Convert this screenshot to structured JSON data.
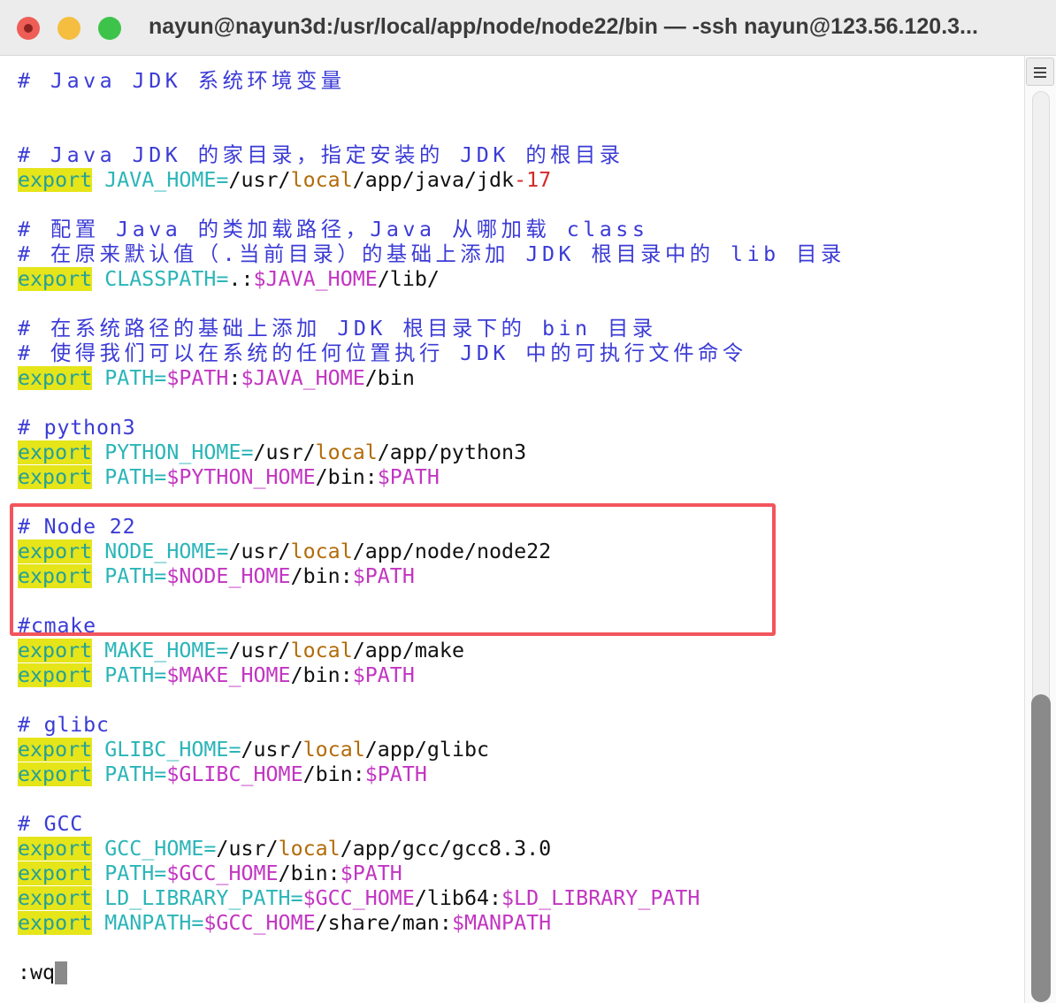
{
  "window": {
    "title": "nayun@nayun3d:/usr/local/app/node/node22/bin — -ssh nayun@123.56.120.3...",
    "buttons": [
      "close",
      "minimize",
      "zoom"
    ]
  },
  "colors": {
    "comment": "#3b3bd6",
    "keyword_bg": "#e5e51a",
    "variable": "#2bb5b8",
    "dollar_var": "#c235c2",
    "local": "#b36b0a",
    "highlight_box": "#f2555c"
  },
  "editor": {
    "lines": [
      {
        "type": "comment",
        "text": "# Java JDK 系统环境变量"
      },
      {
        "type": "blank"
      },
      {
        "type": "blank"
      },
      {
        "type": "comment",
        "text": "# Java JDK 的家目录，指定安装的 JDK 的根目录"
      },
      {
        "type": "code",
        "segments": [
          {
            "c": "kw",
            "t": "export"
          },
          {
            "c": "plain",
            "t": " "
          },
          {
            "c": "var",
            "t": "JAVA_HOME="
          },
          {
            "c": "plain",
            "t": "/usr/"
          },
          {
            "c": "local",
            "t": "local"
          },
          {
            "c": "plain",
            "t": "/app/java/jdk"
          },
          {
            "c": "num",
            "t": "-17"
          }
        ]
      },
      {
        "type": "blank"
      },
      {
        "type": "comment",
        "text": "# 配置 Java 的类加载路径，Java 从哪加载 class"
      },
      {
        "type": "comment",
        "text": "# 在原来默认值（.当前目录）的基础上添加 JDK 根目录中的 lib 目录"
      },
      {
        "type": "code",
        "segments": [
          {
            "c": "kw",
            "t": "export"
          },
          {
            "c": "plain",
            "t": " "
          },
          {
            "c": "var",
            "t": "CLASSPATH="
          },
          {
            "c": "plain",
            "t": ".:"
          },
          {
            "c": "dollar",
            "t": "$JAVA_HOME"
          },
          {
            "c": "plain",
            "t": "/lib/"
          }
        ]
      },
      {
        "type": "blank"
      },
      {
        "type": "comment",
        "text": "# 在系统路径的基础上添加 JDK 根目录下的 bin 目录"
      },
      {
        "type": "comment",
        "text": "# 使得我们可以在系统的任何位置执行 JDK 中的可执行文件命令"
      },
      {
        "type": "code",
        "segments": [
          {
            "c": "kw",
            "t": "export"
          },
          {
            "c": "plain",
            "t": " "
          },
          {
            "c": "var",
            "t": "PATH="
          },
          {
            "c": "dollar",
            "t": "$PATH"
          },
          {
            "c": "plain",
            "t": ":"
          },
          {
            "c": "dollar",
            "t": "$JAVA_HOME"
          },
          {
            "c": "plain",
            "t": "/bin"
          }
        ]
      },
      {
        "type": "blank"
      },
      {
        "type": "comment_ascii",
        "text": "# python3"
      },
      {
        "type": "code",
        "segments": [
          {
            "c": "kw",
            "t": "export"
          },
          {
            "c": "plain",
            "t": " "
          },
          {
            "c": "var",
            "t": "PYTHON_HOME="
          },
          {
            "c": "plain",
            "t": "/usr/"
          },
          {
            "c": "local",
            "t": "local"
          },
          {
            "c": "plain",
            "t": "/app/python3"
          }
        ]
      },
      {
        "type": "code",
        "segments": [
          {
            "c": "kw",
            "t": "export"
          },
          {
            "c": "plain",
            "t": " "
          },
          {
            "c": "var",
            "t": "PATH="
          },
          {
            "c": "dollar",
            "t": "$PYTHON_HOME"
          },
          {
            "c": "plain",
            "t": "/bin:"
          },
          {
            "c": "dollar",
            "t": "$PATH"
          }
        ]
      },
      {
        "type": "blank"
      },
      {
        "type": "comment_ascii",
        "text": "# Node 22"
      },
      {
        "type": "code",
        "segments": [
          {
            "c": "kw",
            "t": "export"
          },
          {
            "c": "plain",
            "t": " "
          },
          {
            "c": "var",
            "t": "NODE_HOME="
          },
          {
            "c": "plain",
            "t": "/usr/"
          },
          {
            "c": "local",
            "t": "local"
          },
          {
            "c": "plain",
            "t": "/app/node/node22"
          }
        ]
      },
      {
        "type": "code",
        "segments": [
          {
            "c": "kw",
            "t": "export"
          },
          {
            "c": "plain",
            "t": " "
          },
          {
            "c": "var",
            "t": "PATH="
          },
          {
            "c": "dollar",
            "t": "$NODE_HOME"
          },
          {
            "c": "plain",
            "t": "/bin:"
          },
          {
            "c": "dollar",
            "t": "$PATH"
          }
        ]
      },
      {
        "type": "blank"
      },
      {
        "type": "comment_ascii",
        "text": "#cmake"
      },
      {
        "type": "code",
        "segments": [
          {
            "c": "kw",
            "t": "export"
          },
          {
            "c": "plain",
            "t": " "
          },
          {
            "c": "var",
            "t": "MAKE_HOME="
          },
          {
            "c": "plain",
            "t": "/usr/"
          },
          {
            "c": "local",
            "t": "local"
          },
          {
            "c": "plain",
            "t": "/app/make"
          }
        ]
      },
      {
        "type": "code",
        "segments": [
          {
            "c": "kw",
            "t": "export"
          },
          {
            "c": "plain",
            "t": " "
          },
          {
            "c": "var",
            "t": "PATH="
          },
          {
            "c": "dollar",
            "t": "$MAKE_HOME"
          },
          {
            "c": "plain",
            "t": "/bin:"
          },
          {
            "c": "dollar",
            "t": "$PATH"
          }
        ]
      },
      {
        "type": "blank"
      },
      {
        "type": "comment_ascii",
        "text": "# glibc"
      },
      {
        "type": "code",
        "segments": [
          {
            "c": "kw",
            "t": "export"
          },
          {
            "c": "plain",
            "t": " "
          },
          {
            "c": "var",
            "t": "GLIBC_HOME="
          },
          {
            "c": "plain",
            "t": "/usr/"
          },
          {
            "c": "local",
            "t": "local"
          },
          {
            "c": "plain",
            "t": "/app/glibc"
          }
        ]
      },
      {
        "type": "code",
        "segments": [
          {
            "c": "kw",
            "t": "export"
          },
          {
            "c": "plain",
            "t": " "
          },
          {
            "c": "var",
            "t": "PATH="
          },
          {
            "c": "dollar",
            "t": "$GLIBC_HOME"
          },
          {
            "c": "plain",
            "t": "/bin:"
          },
          {
            "c": "dollar",
            "t": "$PATH"
          }
        ]
      },
      {
        "type": "blank"
      },
      {
        "type": "comment_ascii",
        "text": "# GCC"
      },
      {
        "type": "code",
        "segments": [
          {
            "c": "kw",
            "t": "export"
          },
          {
            "c": "plain",
            "t": " "
          },
          {
            "c": "var",
            "t": "GCC_HOME="
          },
          {
            "c": "plain",
            "t": "/usr/"
          },
          {
            "c": "local",
            "t": "local"
          },
          {
            "c": "plain",
            "t": "/app/gcc/gcc8.3.0"
          }
        ]
      },
      {
        "type": "code",
        "segments": [
          {
            "c": "kw",
            "t": "export"
          },
          {
            "c": "plain",
            "t": " "
          },
          {
            "c": "var",
            "t": "PATH="
          },
          {
            "c": "dollar",
            "t": "$GCC_HOME"
          },
          {
            "c": "plain",
            "t": "/bin:"
          },
          {
            "c": "dollar",
            "t": "$PATH"
          }
        ]
      },
      {
        "type": "code",
        "segments": [
          {
            "c": "kw",
            "t": "export"
          },
          {
            "c": "plain",
            "t": " "
          },
          {
            "c": "var",
            "t": "LD_LIBRARY_PATH="
          },
          {
            "c": "dollar",
            "t": "$GCC_HOME"
          },
          {
            "c": "plain",
            "t": "/lib64:"
          },
          {
            "c": "dollar",
            "t": "$LD_LIBRARY_PATH"
          }
        ]
      },
      {
        "type": "code",
        "segments": [
          {
            "c": "kw",
            "t": "export"
          },
          {
            "c": "plain",
            "t": " "
          },
          {
            "c": "var",
            "t": "MANPATH="
          },
          {
            "c": "dollar",
            "t": "$GCC_HOME"
          },
          {
            "c": "plain",
            "t": "/share/man:"
          },
          {
            "c": "dollar",
            "t": "$MANPATH"
          }
        ]
      },
      {
        "type": "blank"
      },
      {
        "type": "command",
        "text": ":wq"
      }
    ]
  },
  "scrollbar": {
    "position_fraction": 0.66
  }
}
